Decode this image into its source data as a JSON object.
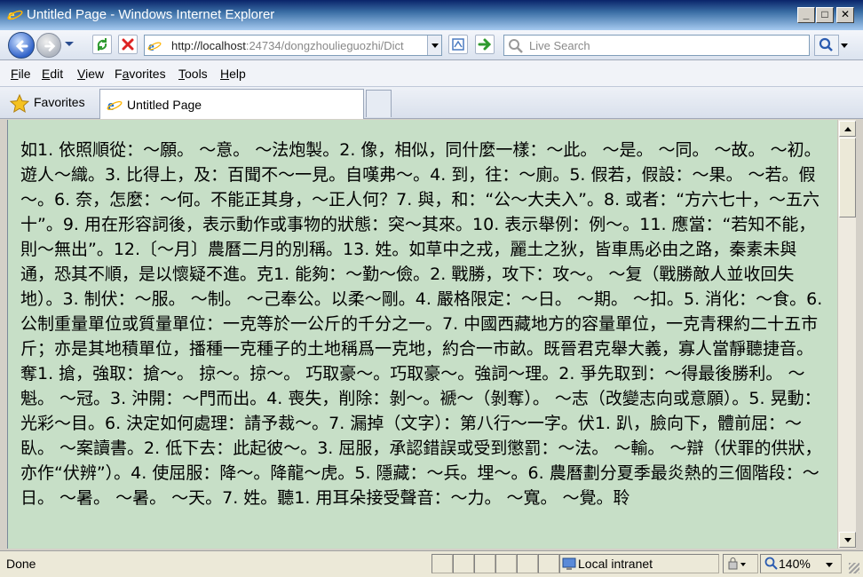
{
  "window": {
    "title": "Untitled Page - Windows Internet Explorer",
    "min_label": "_",
    "max_label": "□",
    "close_label": "✕"
  },
  "navigation": {
    "address_host": "http://localhost",
    "address_rest": ":24734/dongzhoulieguozhi/Dict",
    "search_placeholder": "Live Search"
  },
  "menu": {
    "items": [
      {
        "first": "F",
        "rest": "ile"
      },
      {
        "first": "E",
        "rest": "dit"
      },
      {
        "first": "V",
        "rest": "iew"
      },
      {
        "first": "F",
        "rest": "a",
        "mid": "vorites"
      },
      {
        "first": "T",
        "rest": "ools"
      },
      {
        "first": "H",
        "rest": "elp"
      }
    ]
  },
  "favorites": {
    "label": "Favorites",
    "tab_label": "Untitled Page"
  },
  "content": {
    "text": "如1. 依照順從：～願。 ～意。 ～法炮製。2. 像，相似，同什麼一樣：～此。 ～是。 ～同。 ～故。 ～初。遊人～織。3. 比得上，及：百聞不～一見。自嘆弗～。4. 到，往：～廁。5. 假若，假設：～果。 ～若。假～。6. 奈，怎麼：～何。不能正其身，～正人何？7. 與，和：“公～大夫入”。8. 或者：“方六七十，～五六十”。9. 用在形容詞後，表示動作或事物的狀態：突～其來。10. 表示舉例：例～。11. 應當：“若知不能，則～無出”。12.〔～月〕農曆二月的別稱。13. 姓。如草中之戎，麗土之狄，皆車馬必由之路，秦素未與通，恐其不順，是以懷疑不進。克1. 能夠：～勤～儉。2. 戰勝，攻下：攻～。 ～复（戰勝敵人並收回失地）。3. 制伏：～服。 ～制。 ～己奉公。以柔～剛。4. 嚴格限定：～日。 ～期。 ～扣。5. 消化：～食。6. 公制重量單位或質量單位：一克等於一公斤的千分之一。7. 中國西藏地方的容量單位，一克青稞約二十五市斤；亦是其地積單位，播種一克種子的土地稱爲一克地，約合一市畝。既晉君克舉大義，寡人當靜聽捷音。奪1. 搶，強取：搶～。 掠～。掠～。 巧取豪～。巧取豪～。強詞～理。2. 爭先取到：～得最後勝利。 ～魁。 ～冠。3. 沖開：～門而出。4. 喪失，削除：剝～。褫～（剝奪）。 ～志（改變志向或意願）。5. 晃動：光彩～目。6. 決定如何處理：請予裁～。7. 漏掉（文字）：第八行～一字。伏1. 趴，臉向下，體前屈：～臥。 ～案讀書。2. 低下去：此起彼～。3. 屈服，承認錯誤或受到懲罰：～法。 ～輸。 ～辯（伏罪的供狀，亦作“伏辨”）。4. 使屈服：降～。降龍～虎。5. 隱藏：～兵。埋～。6. 農曆劃分夏季最炎熱的三個階段：～日。 ～暑。 ～暑。 ～天。7. 姓。聽1. 用耳朵接受聲音：～力。 ～寬。 ～覺。聆"
  },
  "status": {
    "done": "Done",
    "zone": "Local intranet",
    "zoom": "140%"
  }
}
